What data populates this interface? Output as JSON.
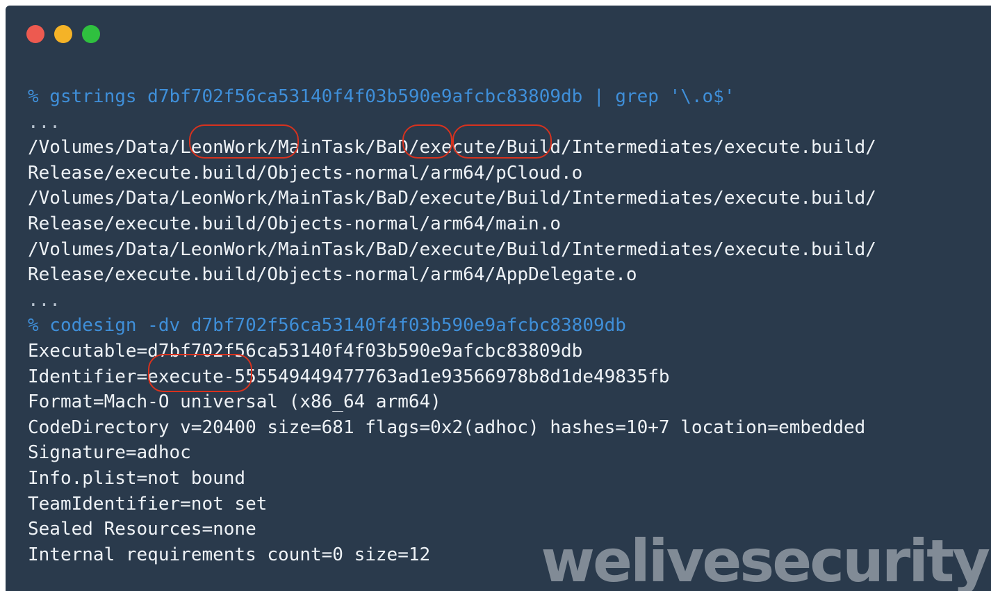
{
  "window": {
    "buttons": [
      {
        "name": "close",
        "color": "#ed5a50"
      },
      {
        "name": "minimize",
        "color": "#f5b327"
      },
      {
        "name": "maximize",
        "color": "#2fc03f"
      }
    ]
  },
  "colors": {
    "background": "#2a3a4c",
    "command": "#3f8fd9",
    "output": "#eef2f6",
    "highlight": "#d8321e"
  },
  "terminal": {
    "lines": [
      "% gstrings d7bf702f56ca53140f4f03b590e9afcbc83809db | grep '\\.o$'",
      "...",
      "/Volumes/Data/LeonWork/MainTask/BaD/execute/Build/Intermediates/execute.build/",
      "Release/execute.build/Objects-normal/arm64/pCloud.o",
      "/Volumes/Data/LeonWork/MainTask/BaD/execute/Build/Intermediates/execute.build/",
      "Release/execute.build/Objects-normal/arm64/main.o",
      "/Volumes/Data/LeonWork/MainTask/BaD/execute/Build/Intermediates/execute.build/",
      "Release/execute.build/Objects-normal/arm64/AppDelegate.o",
      "...",
      "% codesign -dv d7bf702f56ca53140f4f03b590e9afcbc83809db",
      "Executable=d7bf702f56ca53140f4f03b590e9afcbc83809db",
      "Identifier=execute-555549449477763ad1e93566978b8d1de49835fb",
      "Format=Mach-O universal (x86_64 arm64)",
      "CodeDirectory v=20400 size=681 flags=0x2(adhoc) hashes=10+7 location=embedded",
      "Signature=adhoc",
      "Info.plist=not bound",
      "TeamIdentifier=not set",
      "Sealed Resources=none",
      "Internal requirements count=0 size=12"
    ]
  },
  "watermark": "welivesecurity"
}
